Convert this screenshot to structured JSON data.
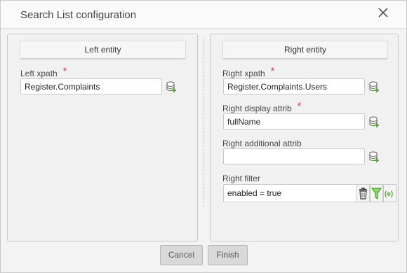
{
  "dialog": {
    "title": "Search List configuration",
    "close_icon": "close-icon"
  },
  "left": {
    "header": "Left entity",
    "xpath_label": "Left xpath",
    "required_mark": "*",
    "xpath_value": "Register.Complaints",
    "db_icon": "database-add-icon"
  },
  "right": {
    "header": "Right entity",
    "xpath_label": "Right xpath",
    "xpath_value": "Register.Complaints.Users",
    "display_label": "Right display attrib",
    "display_value": "fullName",
    "additional_label": "Right additional attrib",
    "additional_value": "",
    "filter_label": "Right filter",
    "filter_value": "enabled = true",
    "required_mark": "*",
    "filter_icons": [
      "trash-icon",
      "funnel-icon",
      "expression-icon"
    ]
  },
  "buttons": {
    "cancel": "Cancel",
    "finish": "Finish"
  },
  "colors": {
    "required": "#e03030",
    "funnel": "#4aa12f",
    "icon_green": "#5aa832"
  }
}
